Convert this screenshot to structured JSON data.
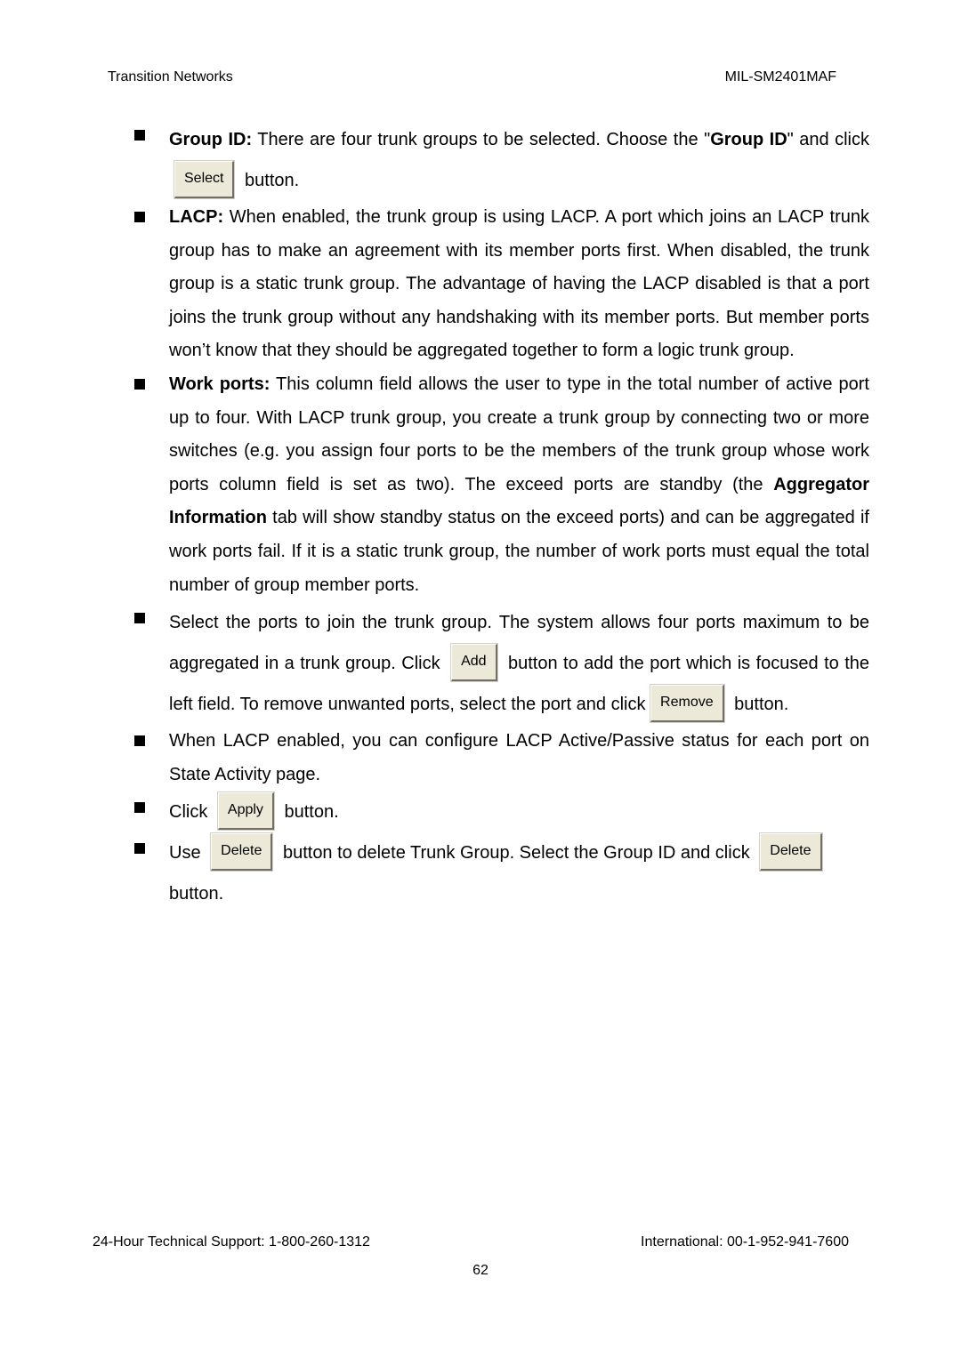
{
  "header": {
    "left": "Transition Networks",
    "right": "MIL-SM2401MAF"
  },
  "items": {
    "group_id": {
      "label": "Group ID:",
      "text1": " There are four trunk groups to be selected. Choose the \"",
      "bold": "Group ID",
      "text2": "\" and click",
      "button": "Select",
      "text3": "button."
    },
    "lacp": {
      "label": "LACP:",
      "text": " When enabled, the trunk group is using LACP. A port which joins an LACP trunk group has to make an agreement with its member ports first. When disabled, the trunk group is a static trunk group. The advantage of having the LACP disabled is that a port joins the trunk group without any handshaking with its member ports. But member ports won’t know that they should be aggregated together to form a logic trunk group."
    },
    "work_ports": {
      "label": "Work ports:",
      "text1": " This column field allows the user to type in the total number of active port up to four. With LACP trunk group, you create a trunk group by connecting two or more switches (e.g. you assign four ports to be the members of the trunk group whose work ports column field is set as two). The exceed ports are standby (the ",
      "bold": "Aggregator Information",
      "text2": " tab will show standby status on the exceed ports) and can be aggregated if work ports fail. If it is a static trunk group, the number of work ports must equal the total number of group member ports."
    },
    "select_ports": {
      "text1": "Select the ports to join the trunk group. The system allows four ports maximum to be aggregated in a trunk group. Click",
      "add_button": "Add",
      "text2": "button to add the port which is focused to the left field. To remove unwanted ports, select the port and click",
      "remove_button": "Remove",
      "text3": "button."
    },
    "lacp_enabled": {
      "text": "When LACP enabled, you can configure LACP Active/Passive status for each port on State Activity page."
    },
    "apply": {
      "text1": "Click",
      "button": "Apply",
      "text2": "button."
    },
    "delete": {
      "text1": "Use",
      "button1": "Delete",
      "text2": "button to delete Trunk Group. Select the Group ID and click",
      "button2": "Delete",
      "text3": "button."
    }
  },
  "footer": {
    "left": "24-Hour Technical Support: 1-800-260-1312",
    "right": "International: 00-1-952-941-7600",
    "page_number": "62"
  }
}
